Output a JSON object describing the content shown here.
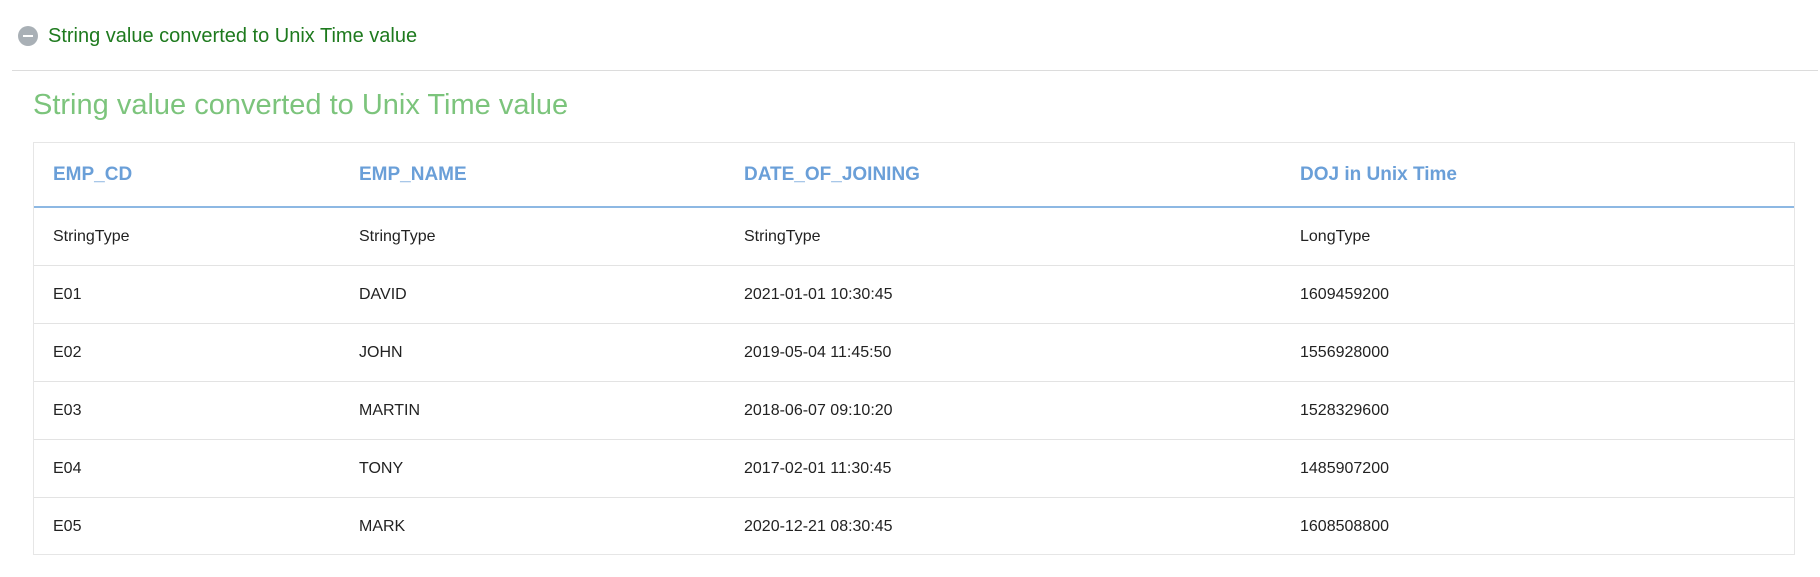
{
  "section": {
    "header_label": "String value converted to Unix Time value",
    "collapse_icon": "minus-circle-icon"
  },
  "panel": {
    "title": "String value converted to Unix Time value"
  },
  "table": {
    "columns": [
      "EMP_CD",
      "EMP_NAME",
      "DATE_OF_JOINING",
      "DOJ in Unix Time"
    ],
    "types": [
      "StringType",
      "StringType",
      "StringType",
      "LongType"
    ],
    "rows": [
      [
        "E01",
        "DAVID",
        "2021-01-01 10:30:45",
        "1609459200"
      ],
      [
        "E02",
        "JOHN",
        "2019-05-04 11:45:50",
        "1556928000"
      ],
      [
        "E03",
        "MARTIN",
        "2018-06-07 09:10:20",
        "1528329600"
      ],
      [
        "E04",
        "TONY",
        "2017-02-01 11:30:45",
        "1485907200"
      ],
      [
        "E05",
        "MARK",
        "2020-12-21 08:30:45",
        "1608508800"
      ]
    ]
  },
  "colors": {
    "header_label": "#1e7a1e",
    "panel_title": "#7cc47c",
    "column_header": "#6a9fd8"
  }
}
